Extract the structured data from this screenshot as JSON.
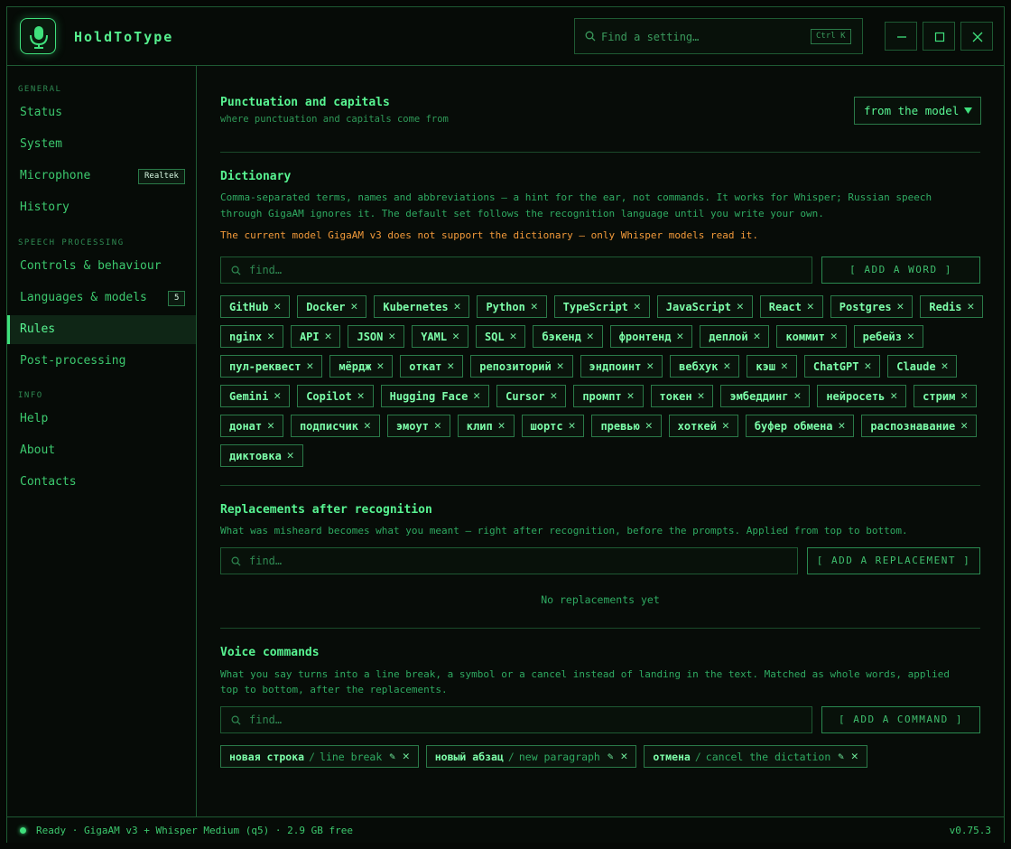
{
  "app": {
    "name": "HoldToType"
  },
  "search": {
    "placeholder": "Find a setting…",
    "shortcut": "Ctrl K"
  },
  "sidebar": {
    "sections": {
      "general": "GENERAL",
      "speech": "SPEECH PROCESSING",
      "info": "INFO"
    },
    "items": [
      {
        "label": "Status"
      },
      {
        "label": "System"
      },
      {
        "label": "Microphone",
        "badge": "Realtek"
      },
      {
        "label": "History"
      },
      {
        "label": "Controls & behaviour"
      },
      {
        "label": "Languages & models",
        "badge": "5"
      },
      {
        "label": "Rules"
      },
      {
        "label": "Post-processing"
      },
      {
        "label": "Help"
      },
      {
        "label": "About"
      },
      {
        "label": "Contacts"
      }
    ]
  },
  "punctuation": {
    "title": "Punctuation and capitals",
    "subtitle": "where punctuation and capitals come from",
    "selected": "from the model"
  },
  "dictionary": {
    "title": "Dictionary",
    "description_line1": "Comma-separated terms, names and abbreviations — a hint for the ear, not commands. It works for Whisper; Russian speech",
    "description_line2": "through GigaAM ignores it. The default set follows the recognition language until you write your own.",
    "warning": "The current model GigaAM v3 does not support the dictionary — only Whisper models read it.",
    "find_placeholder": "find…",
    "add_label": "[ ADD A WORD ]",
    "words": [
      "GitHub",
      "Docker",
      "Kubernetes",
      "Python",
      "TypeScript",
      "JavaScript",
      "React",
      "Postgres",
      "Redis",
      "nginx",
      "API",
      "JSON",
      "YAML",
      "SQL",
      "бэкенд",
      "фронтенд",
      "деплой",
      "коммит",
      "ребейз",
      "пул-реквест",
      "мёрдж",
      "откат",
      "репозиторий",
      "эндпоинт",
      "вебхук",
      "кэш",
      "ChatGPT",
      "Claude",
      "Gemini",
      "Copilot",
      "Hugging Face",
      "Cursor",
      "промпт",
      "токен",
      "эмбеддинг",
      "нейросеть",
      "стрим",
      "донат",
      "подписчик",
      "эмоут",
      "клип",
      "шортс",
      "превью",
      "хоткей",
      "буфер обмена",
      "распознавание",
      "диктовка"
    ]
  },
  "replacements": {
    "title": "Replacements after recognition",
    "description": "What was misheard becomes what you meant — right after recognition, before the prompts. Applied from top to bottom.",
    "find_placeholder": "find…",
    "add_label": "[ ADD A REPLACEMENT ]",
    "empty": "No replacements yet"
  },
  "commands": {
    "title": "Voice commands",
    "description_line1": "What you say turns into a line break, a symbol or a cancel instead of landing in the text. Matched as whole words, applied",
    "description_line2": "top to bottom, after the replacements.",
    "find_placeholder": "find…",
    "add_label": "[ ADD A COMMAND ]",
    "items": [
      {
        "phrase": "новая строка",
        "meaning": "line break"
      },
      {
        "phrase": "новый абзац",
        "meaning": "new paragraph"
      },
      {
        "phrase": "отмена",
        "meaning": "cancel the dictation"
      }
    ]
  },
  "status": {
    "text": "Ready · GigaAM v3 + Whisper Medium (q5) · 2.9 GB free",
    "version": "v0.75.3"
  },
  "colors": {
    "accent": "#3fe07c",
    "warning": "#f29a3a",
    "background": "#070c08"
  }
}
